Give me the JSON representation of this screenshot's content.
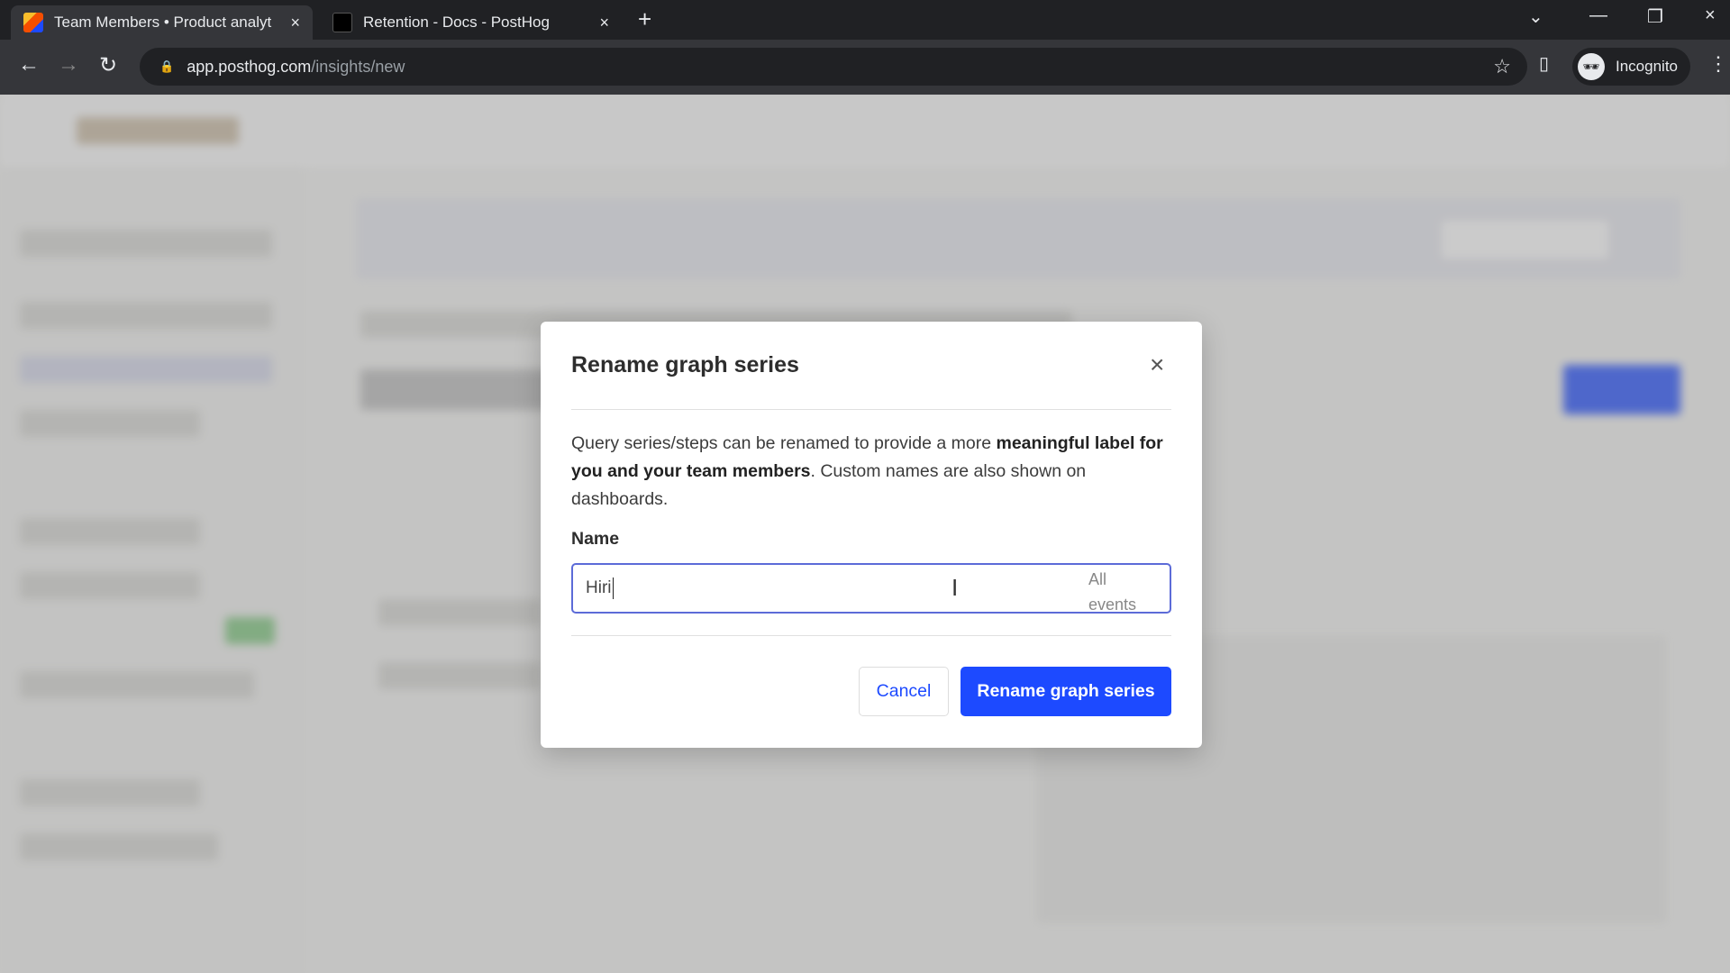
{
  "browser": {
    "tabs": [
      {
        "title": "Team Members • Product analyt",
        "active": true
      },
      {
        "title": "Retention - Docs - PostHog",
        "active": false
      }
    ],
    "url_host": "app.posthog.com",
    "url_path": "/insights/new",
    "profile": "Incognito"
  },
  "icons": {
    "close": "×",
    "new_tab": "+",
    "back": "←",
    "forward": "→",
    "reload": "↻",
    "lock": "🔒",
    "star": "☆",
    "menu": "⋮",
    "incognito": "🕶",
    "ibeam": "I"
  },
  "dialog": {
    "title": "Rename graph series",
    "description_parts": [
      "Query series/steps can be renamed to provide a more ",
      "meaningful label for you and your team members",
      ". Custom names are also shown on dashboards."
    ],
    "name_label": "Name",
    "name_value": "Hiri",
    "name_suffix": "All events",
    "cancel_label": "Cancel",
    "confirm_label": "Rename graph series"
  },
  "colors": {
    "primary": "#1d4aff",
    "input_focus": "#5c6bd8"
  }
}
